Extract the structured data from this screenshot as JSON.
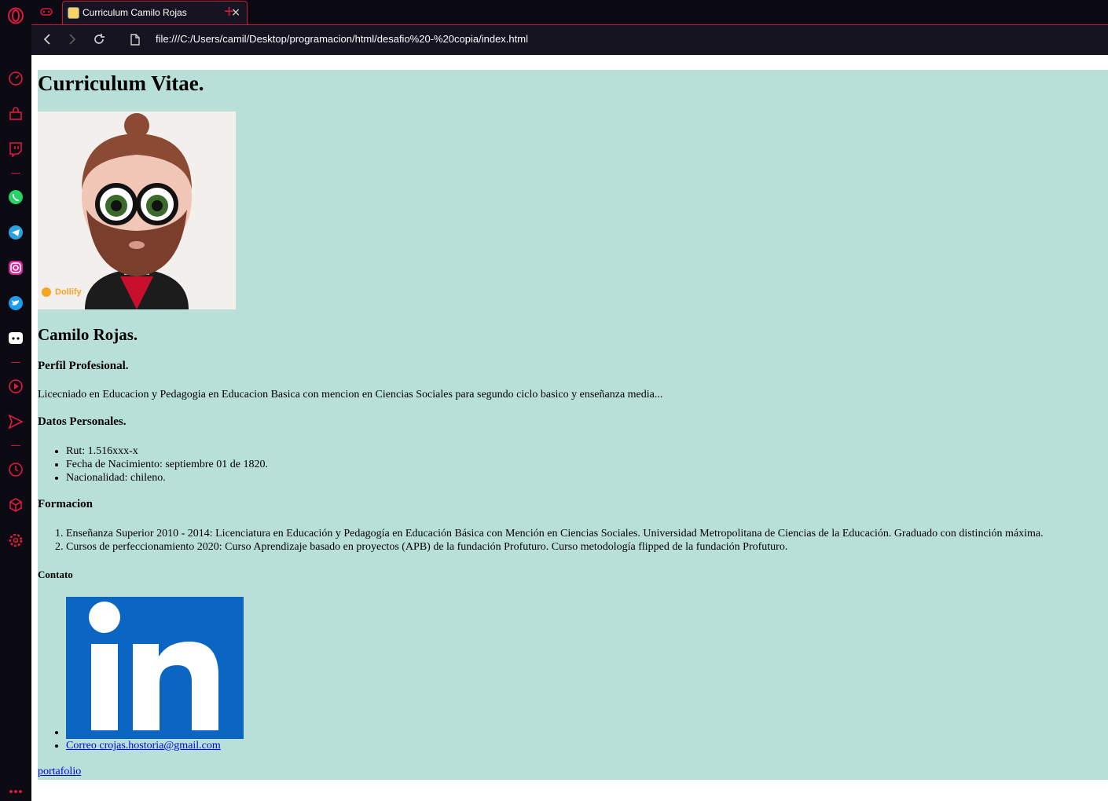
{
  "browser": {
    "tab_title": "Curriculum Camilo Rojas",
    "tab_close": "×",
    "new_tab": "+",
    "url": "file:///C:/Users/camil/Desktop/programacion/html/desafio%20-%20copia/index.html"
  },
  "colors": {
    "accent": "#c4173f",
    "page_bg": "#b8e0d8",
    "linkedin_blue": "#0a66c2",
    "link": "#0000ee"
  },
  "sidebar_icons": [
    "opera-logo-icon",
    "speed-dial-icon",
    "shopping-icon",
    "twitch-icon",
    "whatsapp-icon",
    "telegram-icon",
    "instagram-icon",
    "twitter-icon",
    "discord-icon",
    "player-icon",
    "send-icon",
    "history-icon",
    "extensions-icon",
    "settings-icon",
    "more-icon"
  ],
  "cv": {
    "title": "Curriculum Vitae.",
    "avatar_brand": "Dollify",
    "name": "Camilo Rojas.",
    "perfil_heading": "Perfil Profesional.",
    "perfil_text": "Licecniado en Educacion y Pedagogia en Educacion Basica con mencion en Ciencias Sociales para segundo ciclo basico y enseñanza media...",
    "datos_heading": "Datos Personales.",
    "datos": [
      "Rut: 1.516xxx-x",
      "Fecha de Nacimiento: septiembre 01 de 1820.",
      "Nacionalidad: chileno."
    ],
    "formacion_heading": "Formacion",
    "formacion": [
      "Enseñanza Superior 2010 - 2014: Licenciatura en Educación y Pedagogía en Educación Básica con Mención en Ciencias Sociales. Universidad Metropolitana de Ciencias de la Educación. Graduado con distinción máxima.",
      "Cursos de perfeccionamiento 2020: Curso Aprendizaje basado en proyectos (APB) de la fundación Profuturo. Curso metodología flipped de la fundación Profuturo."
    ],
    "contacto_heading": "Contato",
    "correo": "Correo crojas.hostoria@gmail.com",
    "portafolio": "portafolio"
  }
}
